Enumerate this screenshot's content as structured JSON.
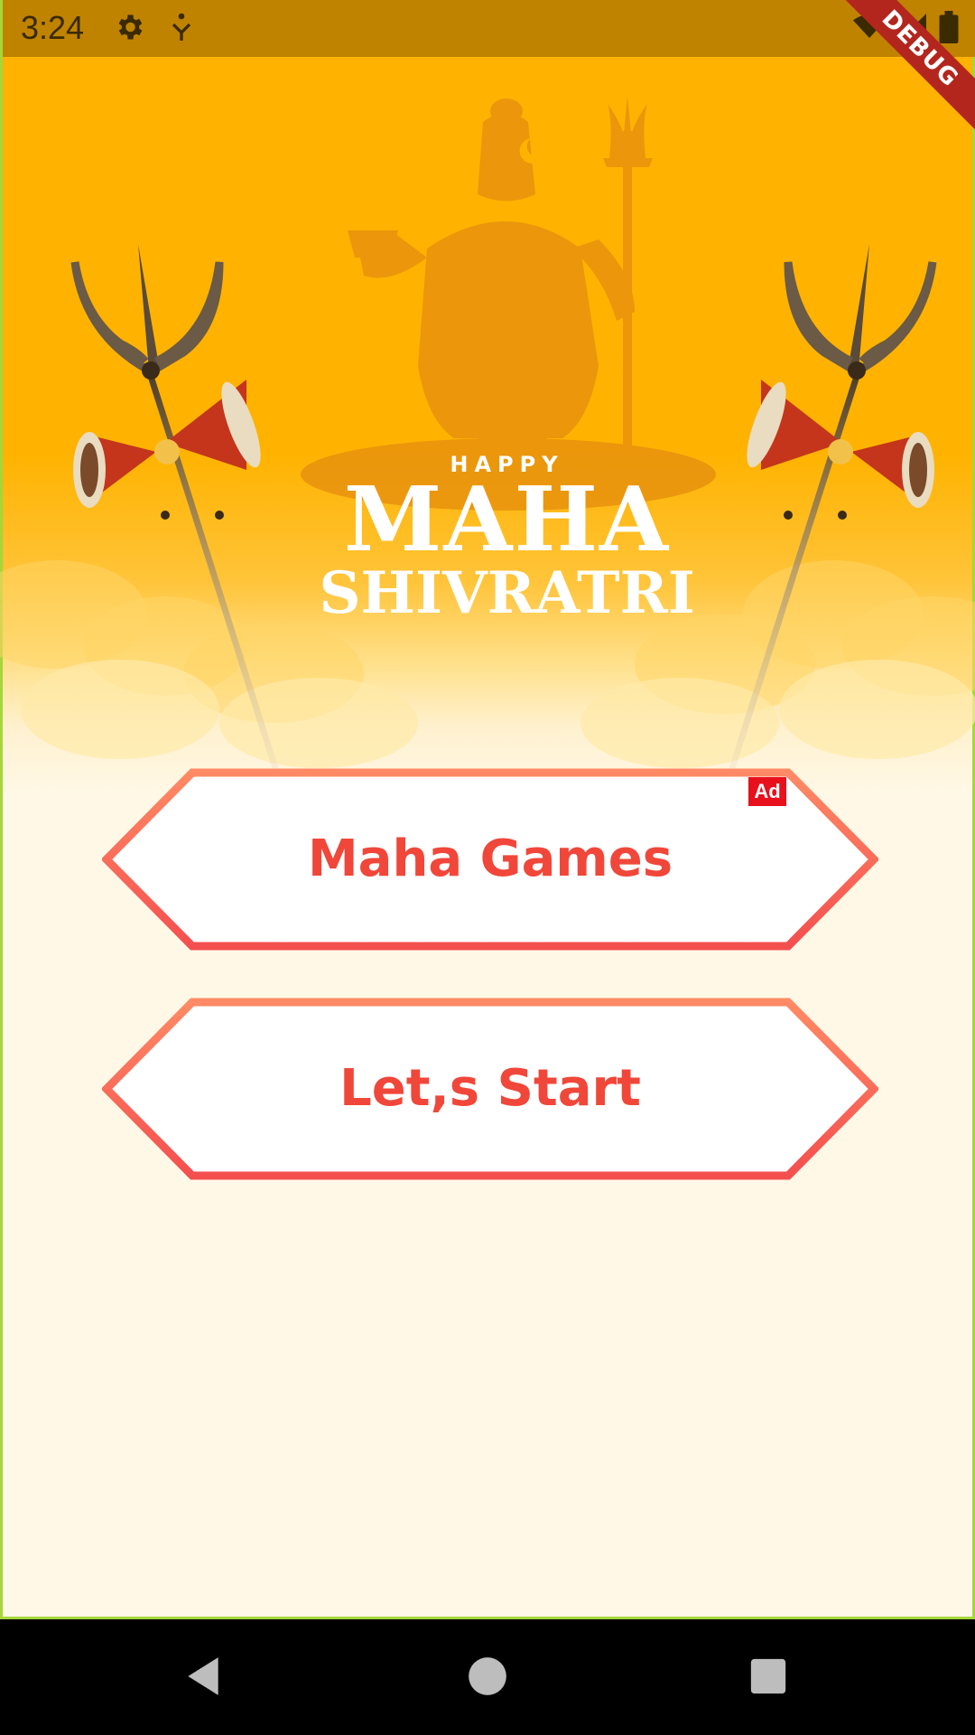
{
  "status_bar": {
    "time": "3:24",
    "icons": [
      "settings-icon",
      "accessibility-icon",
      "wifi-icon",
      "signal-icon",
      "battery-icon"
    ]
  },
  "debug_banner": "DEBUG",
  "banner": {
    "happy": "HAPPY",
    "maha": "MAHA",
    "shivratri": "SHIVRATRI"
  },
  "buttons": {
    "maha_games": "Maha Games",
    "lets_start": "Let,s Start",
    "ad_badge": "Ad"
  },
  "nav_bar": {
    "icons": [
      "back-icon",
      "home-icon",
      "recents-icon"
    ]
  },
  "colors": {
    "background_top": "#ffb300",
    "background_bottom": "#fff8e6",
    "button_text": "#f0473a",
    "button_border_top": "#ff8a65",
    "button_border_bottom": "#f44f4f"
  }
}
